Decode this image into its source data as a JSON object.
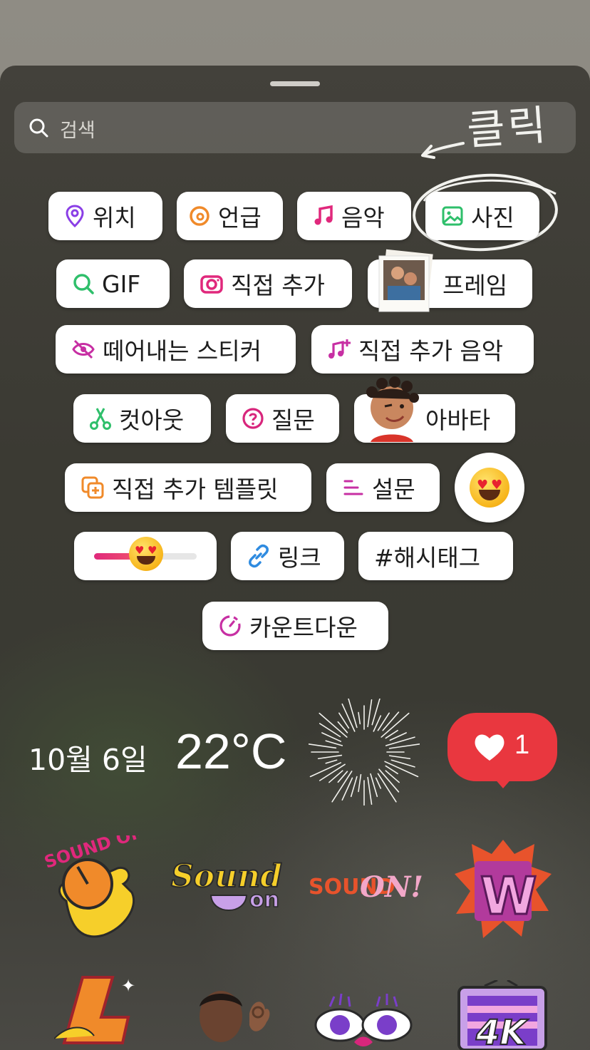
{
  "search": {
    "placeholder": "검색"
  },
  "annotation": {
    "text": "클릭"
  },
  "stickers": {
    "location": "위치",
    "mention": "언급",
    "music": "음악",
    "photo": "사진",
    "gif": "GIF",
    "add_yours": "직접 추가",
    "frame": "프레임",
    "cutout_sticker": "떼어내는 스티커",
    "add_yours_music": "직접 추가 음악",
    "cutout": "컷아웃",
    "question": "질문",
    "avatar": "아바타",
    "add_yours_template": "직접 추가 템플릿",
    "poll": "설문",
    "link": "링크",
    "hashtag": "#해시태그",
    "countdown": "카운트다운"
  },
  "emoji_slider": {
    "value": 0.5
  },
  "info_row": {
    "date": "10월 6일",
    "temperature": "22°C",
    "like_count": "1"
  },
  "gif_stickers": [
    {
      "text": "SOUND ON"
    },
    {
      "text": "Sound on"
    },
    {
      "text": "SOUND ON!"
    },
    {
      "text": "W"
    },
    {
      "text": "L"
    },
    {
      "text": "4K"
    }
  ],
  "colors": {
    "accent_purple": "#9b3fd9",
    "accent_pink": "#d8267c",
    "accent_green": "#2fbf6b",
    "like_red": "#e9373f"
  }
}
